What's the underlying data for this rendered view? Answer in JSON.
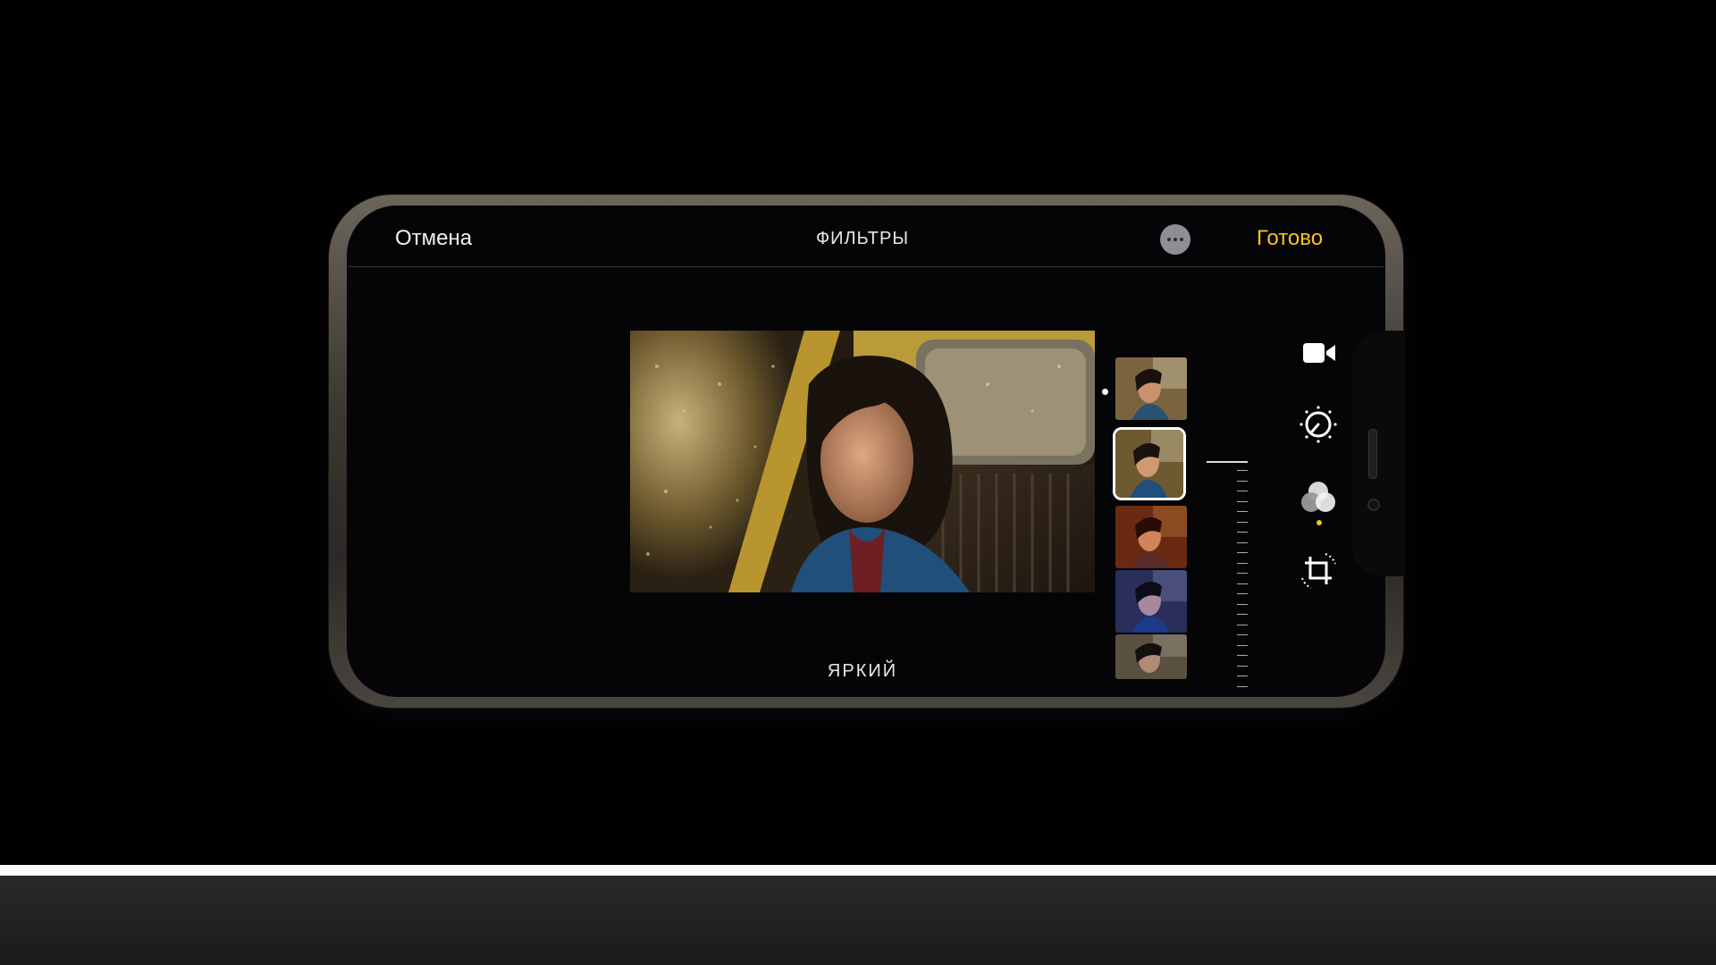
{
  "topbar": {
    "cancel_label": "Отмена",
    "title": "ФИЛЬТРЫ",
    "more_label": "•••",
    "done_label": "Готово"
  },
  "filter": {
    "current_name": "ЯРКИЙ",
    "selected_index": 1
  },
  "thumbnails": [
    "thumb-original",
    "thumb-vivid",
    "thumb-vivid-warm",
    "thumb-vivid-cool",
    "thumb-dramatic"
  ],
  "tools": [
    "video-camera-icon",
    "adjust-dial-icon",
    "filters-icon",
    "crop-rotate-icon"
  ],
  "active_tool": "filters-icon",
  "colors": {
    "accent": "#f5c518",
    "background": "#000000",
    "screen": "#050407"
  }
}
